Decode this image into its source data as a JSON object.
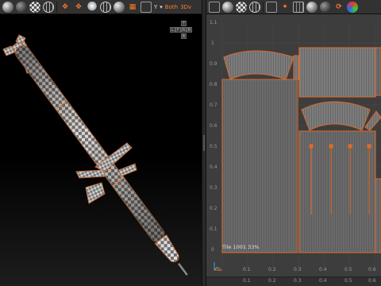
{
  "left_viewport": {
    "toolbar": {
      "icons": [
        "shaded-sphere-icon",
        "dark-sphere-icon",
        "checker-sphere-icon",
        "wireframe-sphere-icon",
        "move-icon",
        "light-bulb-icon",
        "sphere-outline-icon",
        "grid-tool-icon",
        "camera-icon"
      ],
      "shading_mode_label": "Both",
      "axis_label": "Y",
      "mode_3d_label": "3Dv"
    },
    "view_cube": {
      "top": "T",
      "left": "L",
      "front": "F",
      "right": "R",
      "back": "B",
      "bottom": "B"
    }
  },
  "right_viewport": {
    "toolbar": {
      "icons": [
        "frame-icon",
        "sphere-icon",
        "checker-sphere-icon",
        "grid-sphere-icon",
        "box-icon",
        "pinned-icon",
        "grid-icon",
        "rotate-icon",
        "swatch-icon"
      ]
    },
    "v_ticks": [
      "1.1",
      "1",
      "0.9",
      "0.8",
      "0.7",
      "0.6",
      "0.5",
      "0.4",
      "0.3",
      "0.2",
      "0.1",
      "0"
    ],
    "u_ticks": [
      "0.1",
      "0.2",
      "0.3",
      "0.4",
      "0.5",
      "0.6",
      "0.7"
    ],
    "corner_label": "0",
    "tile_label": "Tile 1001 33%",
    "bottom_ticks": [
      "0.1",
      "0.2",
      "0.3",
      "0.4",
      "0.5",
      "0.6",
      "0.7"
    ]
  },
  "colors": {
    "accent": "#ff7a2a",
    "uv_edge": "#e06a2a",
    "background": "#3d3d3d"
  }
}
